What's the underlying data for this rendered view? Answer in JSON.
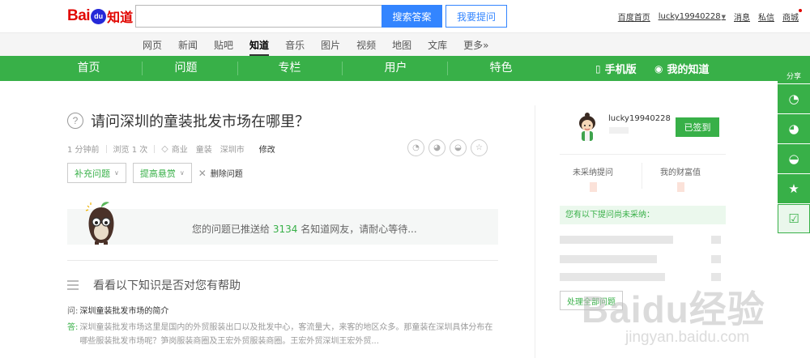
{
  "logo": {
    "part1": "Bai",
    "part2": "du",
    "part3": "知道"
  },
  "search": {
    "value": "",
    "placeholder": "",
    "button": "搜索答案",
    "ask_button": "我要提问"
  },
  "userlinks": {
    "home": "百度首页",
    "username": "lucky19940228",
    "messages": "消息",
    "private": "私信",
    "mall": "商城"
  },
  "prodnav": [
    "网页",
    "新闻",
    "贴吧",
    "知道",
    "音乐",
    "图片",
    "视频",
    "地图",
    "文库",
    "更多»"
  ],
  "prodnav_active": 3,
  "greenmenu": {
    "tabs": [
      "首页",
      "问题",
      "专栏",
      "用户",
      "特色"
    ],
    "mobile": "手机版",
    "my": "我的知道"
  },
  "question": {
    "mark": "?",
    "title": "请问深圳的童装批发市场在哪里？",
    "time": "1 分钟前",
    "views": "浏览 1 次",
    "tags": [
      "商业",
      "童装",
      "深圳市"
    ],
    "edit": "修改",
    "supplement": "补充问题",
    "raise_reward": "提高悬赏",
    "delete": "删除问题"
  },
  "push": {
    "before": "您的问题已推送给 ",
    "count": "3134",
    "after": " 名知道网友，请耐心等待..."
  },
  "knowledge": {
    "heading": "看看以下知识是否对您有帮助",
    "q_prefix": "问:",
    "q": "深圳童装批发市场的简介",
    "a_prefix": "答:",
    "a": "深圳童装批发市场这里是国内的外贸服装出口以及批发中心，客流量大，来客的地区众多。那童装在深圳具体分布在哪些服装批发市场呢？笋岗服装商圈及王宏外贸服装商圈。王宏外贸深圳王宏外贸..."
  },
  "sidebar": {
    "username": "lucky19940228",
    "signed": "已签到",
    "unadopted_label": "未采纳提问",
    "wealth_label": "我的财富值",
    "unadopted_title": "您有以下提问尚未采纳：",
    "handle_all": "处理全部问题"
  },
  "sharebar": {
    "title": "分享"
  },
  "watermark": {
    "big": "Baidu经验",
    "small": "jingyan.baidu.com"
  }
}
